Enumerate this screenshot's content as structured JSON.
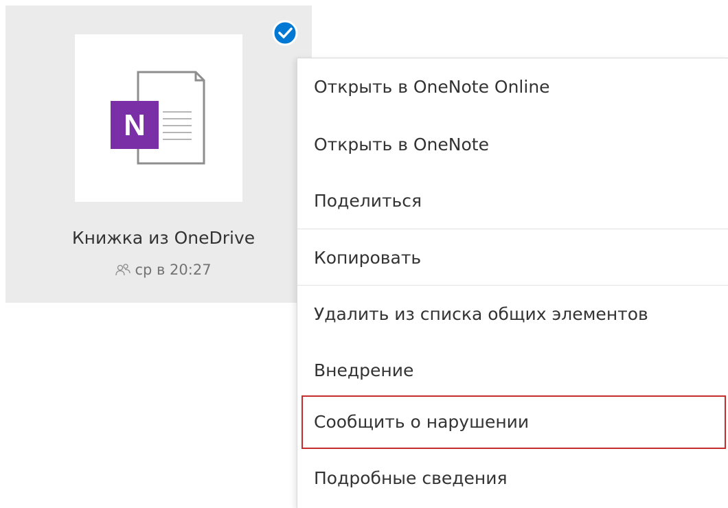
{
  "file_tile": {
    "name": "Книжка из OneDrive",
    "modified": "ср в 20:27",
    "app_badge_letter": "N",
    "app_color": "#7a2fa6",
    "selected": true,
    "check_color": "#0078d4",
    "thumbnail_icon": "onenote-icon",
    "shared_icon": "people-icon"
  },
  "context_menu": {
    "items": [
      {
        "label": "Открыть в OneNote Online"
      },
      {
        "label": "Открыть в OneNote"
      },
      {
        "label": "Поделиться"
      },
      {
        "label": "Копировать"
      },
      {
        "label": "Удалить из списка общих элементов"
      },
      {
        "label": "Внедрение"
      },
      {
        "label": "Сообщить о нарушении",
        "highlighted": true,
        "highlight_color": "#c42b2b"
      },
      {
        "label": "Подробные сведения"
      }
    ]
  }
}
